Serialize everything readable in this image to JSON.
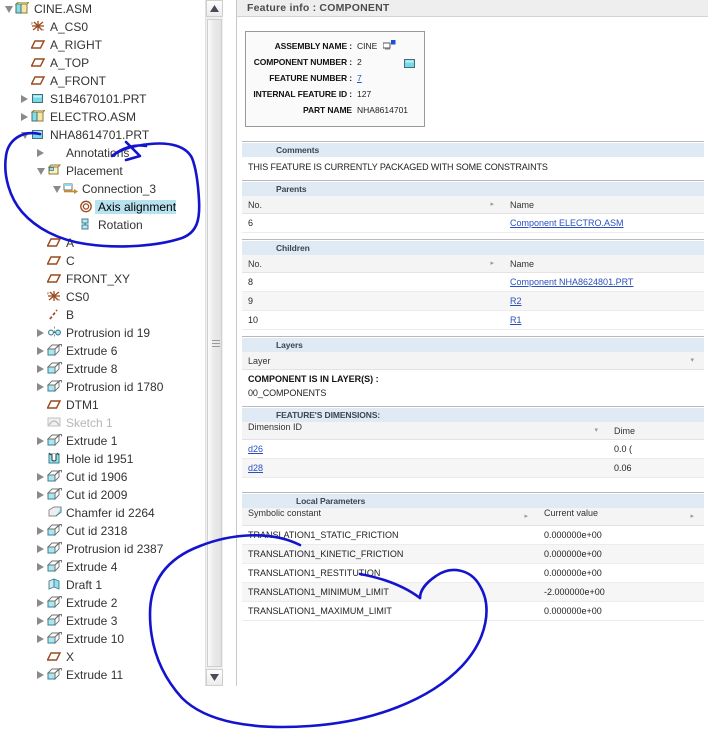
{
  "tree": {
    "name": "model-tree",
    "items": [
      {
        "label": "CINE.ASM",
        "indent": 0,
        "twisty": "down",
        "icon": "assembly-icon"
      },
      {
        "label": "A_CS0",
        "indent": 1,
        "twisty": "none",
        "icon": "coordinate-system-icon"
      },
      {
        "label": "A_RIGHT",
        "indent": 1,
        "twisty": "none",
        "icon": "datum-plane-icon"
      },
      {
        "label": "A_TOP",
        "indent": 1,
        "twisty": "none",
        "icon": "datum-plane-icon"
      },
      {
        "label": "A_FRONT",
        "indent": 1,
        "twisty": "none",
        "icon": "datum-plane-icon"
      },
      {
        "label": "S1B4670101.PRT",
        "indent": 1,
        "twisty": "right",
        "icon": "part-icon"
      },
      {
        "label": "ELECTRO.ASM",
        "indent": 1,
        "twisty": "right",
        "icon": "assembly-icon"
      },
      {
        "label": "NHA8614701.PRT",
        "indent": 1,
        "twisty": "down",
        "icon": "part-icon"
      },
      {
        "label": "Annotations",
        "indent": 2,
        "twisty": "right",
        "icon": "none"
      },
      {
        "label": "Placement",
        "indent": 2,
        "twisty": "down",
        "icon": "placement-icon"
      },
      {
        "label": "Connection_3",
        "indent": 3,
        "twisty": "down",
        "icon": "connection-icon"
      },
      {
        "label": "Axis alignment",
        "indent": 4,
        "twisty": "none",
        "icon": "axis-alignment-icon",
        "selected": true
      },
      {
        "label": "Rotation",
        "indent": 4,
        "twisty": "none",
        "icon": "rotation-icon"
      },
      {
        "label": "A",
        "indent": 2,
        "twisty": "none",
        "icon": "datum-plane-icon"
      },
      {
        "label": "C",
        "indent": 2,
        "twisty": "none",
        "icon": "datum-plane-icon"
      },
      {
        "label": "FRONT_XY",
        "indent": 2,
        "twisty": "none",
        "icon": "datum-plane-icon"
      },
      {
        "label": "CS0",
        "indent": 2,
        "twisty": "none",
        "icon": "coordinate-system-icon"
      },
      {
        "label": "B",
        "indent": 2,
        "twisty": "none",
        "icon": "datum-axis-icon"
      },
      {
        "label": "Protrusion id 19",
        "indent": 2,
        "twisty": "right",
        "icon": "revolve-icon"
      },
      {
        "label": "Extrude 6",
        "indent": 2,
        "twisty": "right",
        "icon": "extrude-icon"
      },
      {
        "label": "Extrude 8",
        "indent": 2,
        "twisty": "right",
        "icon": "extrude-icon"
      },
      {
        "label": "Protrusion id 1780",
        "indent": 2,
        "twisty": "right",
        "icon": "extrude-icon"
      },
      {
        "label": "DTM1",
        "indent": 2,
        "twisty": "none",
        "icon": "datum-plane-icon"
      },
      {
        "label": "Sketch 1",
        "indent": 2,
        "twisty": "none",
        "icon": "sketch-icon",
        "dim": true
      },
      {
        "label": "Extrude 1",
        "indent": 2,
        "twisty": "right",
        "icon": "extrude-icon"
      },
      {
        "label": "Hole id 1951",
        "indent": 2,
        "twisty": "none",
        "icon": "hole-icon"
      },
      {
        "label": "Cut id 1906",
        "indent": 2,
        "twisty": "right",
        "icon": "extrude-icon"
      },
      {
        "label": "Cut id 2009",
        "indent": 2,
        "twisty": "right",
        "icon": "extrude-icon"
      },
      {
        "label": "Chamfer id 2264",
        "indent": 2,
        "twisty": "none",
        "icon": "chamfer-icon"
      },
      {
        "label": "Cut id 2318",
        "indent": 2,
        "twisty": "right",
        "icon": "extrude-icon"
      },
      {
        "label": "Protrusion id 2387",
        "indent": 2,
        "twisty": "right",
        "icon": "extrude-icon"
      },
      {
        "label": "Extrude 4",
        "indent": 2,
        "twisty": "right",
        "icon": "extrude-icon"
      },
      {
        "label": "Draft 1",
        "indent": 2,
        "twisty": "none",
        "icon": "draft-icon"
      },
      {
        "label": "Extrude 2",
        "indent": 2,
        "twisty": "right",
        "icon": "extrude-icon"
      },
      {
        "label": "Extrude 3",
        "indent": 2,
        "twisty": "right",
        "icon": "extrude-icon"
      },
      {
        "label": "Extrude 10",
        "indent": 2,
        "twisty": "right",
        "icon": "extrude-icon"
      },
      {
        "label": "X",
        "indent": 2,
        "twisty": "none",
        "icon": "datum-plane-icon"
      },
      {
        "label": "Extrude 11",
        "indent": 2,
        "twisty": "right",
        "icon": "extrude-icon"
      }
    ]
  },
  "info": {
    "title": "Feature info : COMPONENT",
    "header": {
      "assembly_name_label": "ASSEMBLY NAME :",
      "assembly_name_value": "CINE",
      "component_number_label": "COMPONENT NUMBER :",
      "component_number_value": "2",
      "feature_number_label": "FEATURE NUMBER :",
      "feature_number_value": "7",
      "internal_feature_id_label": "INTERNAL FEATURE ID :",
      "internal_feature_id_value": "127",
      "part_name_label": "PART NAME",
      "part_name_value": "NHA8614701"
    },
    "comments": {
      "title": "Comments",
      "text": "THIS FEATURE IS CURRENTLY PACKAGED WITH SOME CONSTRAINTS"
    },
    "parents": {
      "title": "Parents",
      "columns": [
        "No.",
        "",
        "Name"
      ],
      "rows": [
        {
          "no": "6",
          "mid": "",
          "name": "Component ELECTRO.ASM"
        }
      ]
    },
    "children": {
      "title": "Children",
      "columns": [
        "No.",
        "",
        "Name"
      ],
      "rows": [
        {
          "no": "8",
          "mid": "",
          "name": "Component NHA8624801.PRT"
        },
        {
          "no": "9",
          "mid": "",
          "name": "R2"
        },
        {
          "no": "10",
          "mid": "",
          "name": "R1"
        }
      ]
    },
    "layers": {
      "title": "Layers",
      "column": "Layer",
      "in_layers_label": "COMPONENT IS IN LAYER(S) :",
      "layer_value": "00_COMPONENTS"
    },
    "dimensions": {
      "title": "FEATURE'S DIMENSIONS:",
      "columns": [
        "Dimension ID",
        "Dime"
      ],
      "rows": [
        {
          "id": "d26",
          "value": "0.0 ("
        },
        {
          "id": "d28",
          "value": "0.06 "
        }
      ]
    },
    "local_parameters": {
      "title": "Local Parameters",
      "columns": [
        "Symbolic constant",
        "",
        "Current value",
        ""
      ],
      "rows": [
        {
          "name": "TRANSLATION1_STATIC_FRICTION",
          "value": "0.000000e+00"
        },
        {
          "name": "TRANSLATION1_KINETIC_FRICTION",
          "value": "0.000000e+00"
        },
        {
          "name": "TRANSLATION1_RESTITUTION",
          "value": "0.000000e+00"
        },
        {
          "name": "TRANSLATION1_MINIMUM_LIMIT",
          "value": "-2.000000e+00"
        },
        {
          "name": "TRANSLATION1_MAXIMUM_LIMIT",
          "value": "0.000000e+00"
        }
      ]
    }
  },
  "annotation": {
    "color": "#1414cf",
    "shapes": [
      "tree-placement-circle",
      "local-parameters-circle"
    ]
  },
  "scrollbar": {
    "up_glyph": "▲",
    "down_glyph": "▼"
  }
}
